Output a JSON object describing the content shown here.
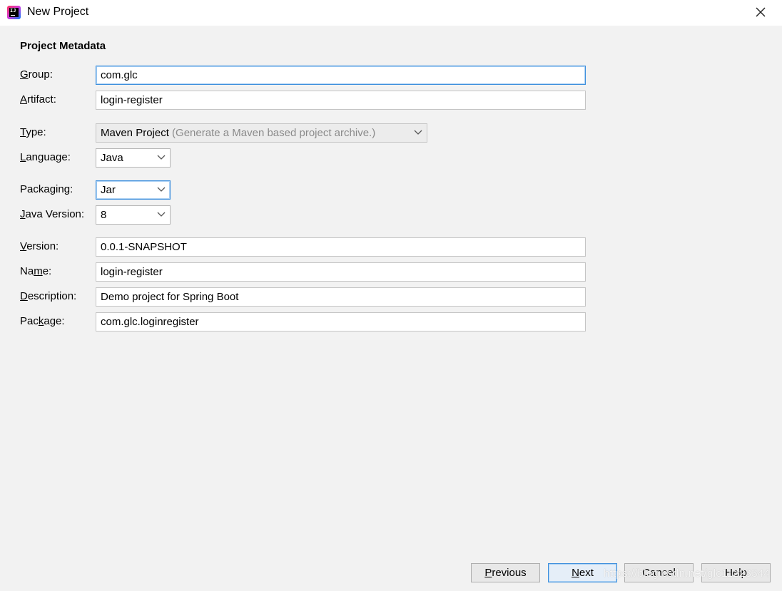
{
  "window": {
    "title": "New Project",
    "close_glyph": "×"
  },
  "section_title": "Project Metadata",
  "labels": {
    "group": {
      "pre": "",
      "mn": "G",
      "post": "roup:"
    },
    "artifact": {
      "pre": "",
      "mn": "A",
      "post": "rtifact:"
    },
    "type": {
      "pre": "",
      "mn": "T",
      "post": "ype:"
    },
    "language": {
      "pre": "",
      "mn": "L",
      "post": "anguage:"
    },
    "packaging": {
      "pre": "Packa",
      "mn": "g",
      "post": "ing:"
    },
    "java_version": {
      "pre": "",
      "mn": "J",
      "post": "ava Version:"
    },
    "version": {
      "pre": "",
      "mn": "V",
      "post": "ersion:"
    },
    "name": {
      "pre": "Na",
      "mn": "m",
      "post": "e:"
    },
    "description": {
      "pre": "",
      "mn": "D",
      "post": "escription:"
    },
    "package": {
      "pre": "Pac",
      "mn": "k",
      "post": "age:"
    }
  },
  "values": {
    "group": "com.glc",
    "artifact": "login-register",
    "type": "Maven Project",
    "type_hint": "(Generate a Maven based project archive.)",
    "language": "Java",
    "packaging": "Jar",
    "java_version": "8",
    "version": "0.0.1-SNAPSHOT",
    "name": "login-register",
    "description": "Demo project for Spring Boot",
    "package": "com.glc.loginregister"
  },
  "buttons": {
    "previous": {
      "mn": "P",
      "post": "revious"
    },
    "next": {
      "mn": "N",
      "post": "ext"
    },
    "cancel": "Cancel",
    "help": "Help"
  },
  "watermark": "https://blog.csdn.net/glc11223344",
  "colors": {
    "background": "#f2f2f2",
    "focus_border": "#3d8fdd",
    "hint_text": "#8a8a8a"
  }
}
